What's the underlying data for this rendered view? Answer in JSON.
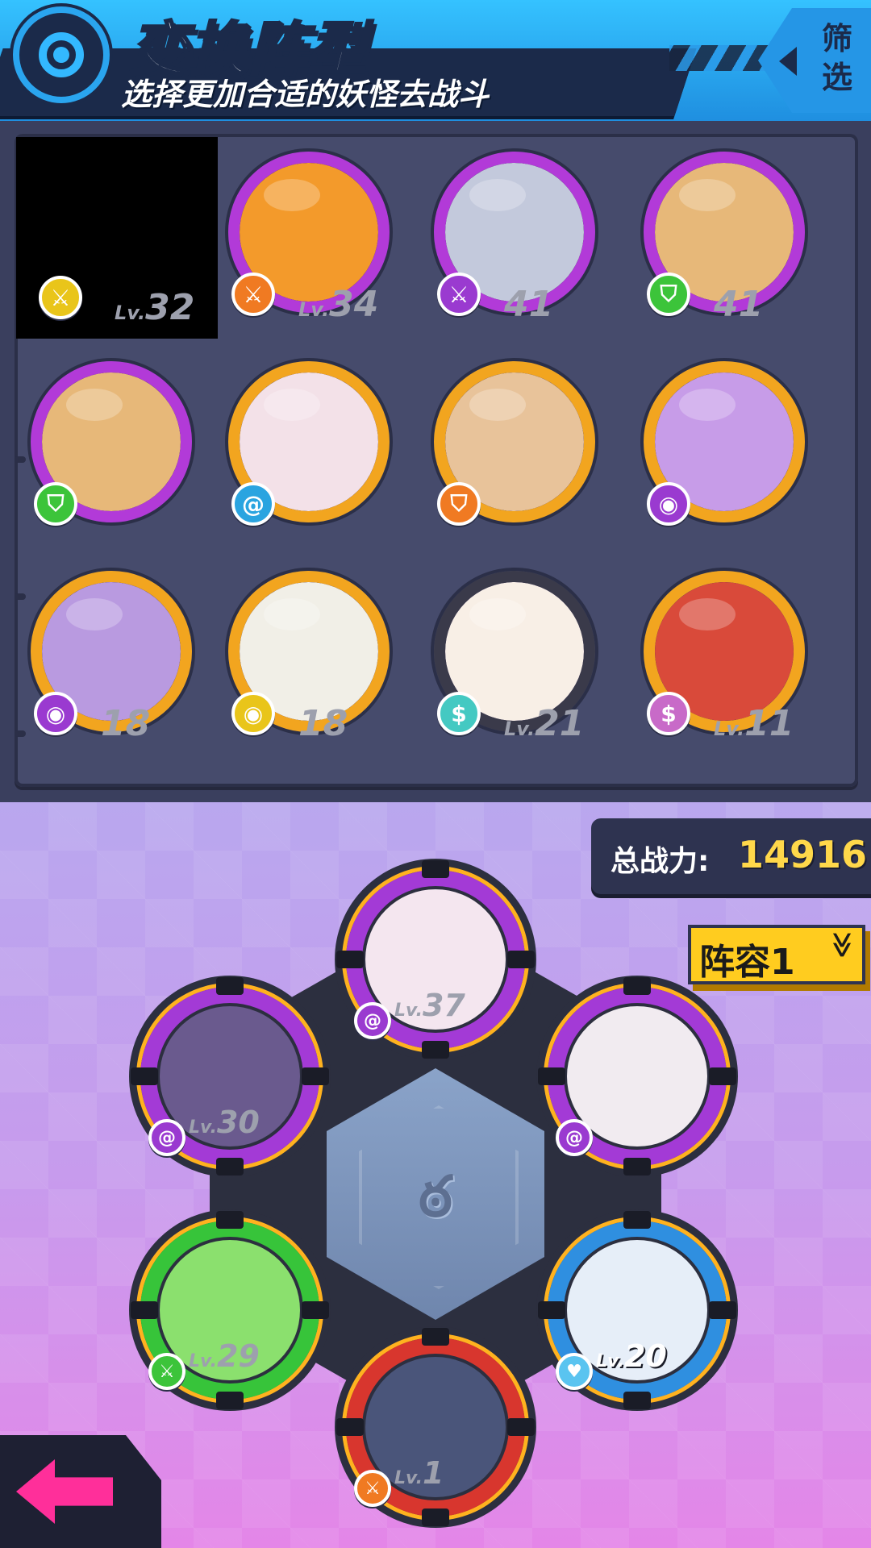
{
  "header": {
    "title": "变换阵型",
    "subtitle": "选择更加合适的妖怪去战斗",
    "filter_label": "筛选"
  },
  "colors": {
    "header_blue": "#35c2ff",
    "dark_navy": "#1b2a4a",
    "panel": "#464b6c",
    "power_gold": "#ffd84a",
    "lineup_yellow": "#ffcc1f",
    "back_arrow": "#ff2f9a"
  },
  "roster": [
    {
      "name": "empty",
      "badge": "sword-icon",
      "badge_color": "#e9c51a",
      "ring": "#000000",
      "face": "#000000",
      "level_prefix": "Lv.",
      "level": "32",
      "redacted": true
    },
    {
      "name": "fire-sprite",
      "badge": "sword-icon",
      "badge_color": "#f07a22",
      "ring": "#b23ad8",
      "face": "#f39a2b",
      "level_prefix": "Lv.",
      "level": "34"
    },
    {
      "name": "horned-demon",
      "badge": "sword-icon",
      "badge_color": "#9a3ad0",
      "ring": "#b23ad8",
      "face": "#c3c9dc",
      "level_prefix": "",
      "level": "41"
    },
    {
      "name": "masked-ninja",
      "badge": "shield-icon",
      "badge_color": "#3cc43a",
      "ring": "#b23ad8",
      "face": "#e7b879",
      "level_prefix": "",
      "level": "41"
    },
    {
      "name": "masked-ninja-2",
      "badge": "shield-icon",
      "badge_color": "#3cc43a",
      "ring": "#b23ad8",
      "face": "#e7b879",
      "level_prefix": "",
      "level": ""
    },
    {
      "name": "horned-girl",
      "badge": "swirl-icon",
      "badge_color": "#2aa4e0",
      "ring": "#f2a51f",
      "face": "#f3e1e8",
      "level_prefix": "",
      "level": ""
    },
    {
      "name": "caped-boy",
      "badge": "shield-icon",
      "badge_color": "#f07a22",
      "ring": "#f2a51f",
      "face": "#e8c39a",
      "level_prefix": "",
      "level": ""
    },
    {
      "name": "purple-twin-girl",
      "badge": "eye-icon",
      "badge_color": "#9a3ad0",
      "ring": "#f2a51f",
      "face": "#c79ce8",
      "level_prefix": "",
      "level": ""
    },
    {
      "name": "glasses-girl",
      "badge": "eye-icon",
      "badge_color": "#9a3ad0",
      "ring": "#f2a51f",
      "face": "#b99ae0",
      "level_prefix": "",
      "level": "18"
    },
    {
      "name": "hooded-elf",
      "badge": "eye-icon",
      "badge_color": "#e9c51a",
      "ring": "#f2a51f",
      "face": "#f1efe7",
      "level_prefix": "",
      "level": "18"
    },
    {
      "name": "bunny",
      "badge": "bag-icon",
      "badge_color": "#44c9c2",
      "ring": "#3a3a4a",
      "face": "#f8efe6",
      "level_prefix": "Lv.",
      "level": "21"
    },
    {
      "name": "feather-chief",
      "badge": "bag-icon",
      "badge_color": "#c86ac8",
      "ring": "#f2a51f",
      "face": "#d94a3a",
      "level_prefix": "Lv.",
      "level": "11"
    }
  ],
  "power": {
    "label": "总战力:",
    "value": "14916"
  },
  "lineup": {
    "label": "阵容1",
    "chevron": "≫"
  },
  "center_glyph": "ఠ",
  "formation": [
    {
      "name": "slot-top",
      "ring": "#a33ad6",
      "face": "#f4e6ef",
      "badge": "swirl-icon",
      "badge_color": "#9a3ad0",
      "level_prefix": "Lv.",
      "level": "37"
    },
    {
      "name": "slot-upper-left",
      "ring": "#a33ad6",
      "face": "#6a5a8e",
      "badge": "swirl-icon",
      "badge_color": "#9a3ad0",
      "level_prefix": "Lv.",
      "level": "30"
    },
    {
      "name": "slot-upper-right",
      "ring": "#a33ad6",
      "face": "#f1ebf0",
      "badge": "swirl-icon",
      "badge_color": "#9a3ad0",
      "level_prefix": "",
      "level": ""
    },
    {
      "name": "slot-lower-left",
      "ring": "#37c43a",
      "face": "#8be06e",
      "badge": "sword-icon",
      "badge_color": "#3cc43a",
      "level_prefix": "Lv.",
      "level": "29"
    },
    {
      "name": "slot-lower-right",
      "ring": "#2f8fe0",
      "face": "#e6eef8",
      "badge": "heart-icon",
      "badge_color": "#5ac4f0",
      "level_prefix": "Lv.",
      "level": "20"
    },
    {
      "name": "slot-bottom",
      "ring": "#d8362e",
      "face": "#4a557a",
      "badge": "sword-icon",
      "badge_color": "#f07a22",
      "level_prefix": "Lv.",
      "level": "1"
    }
  ]
}
